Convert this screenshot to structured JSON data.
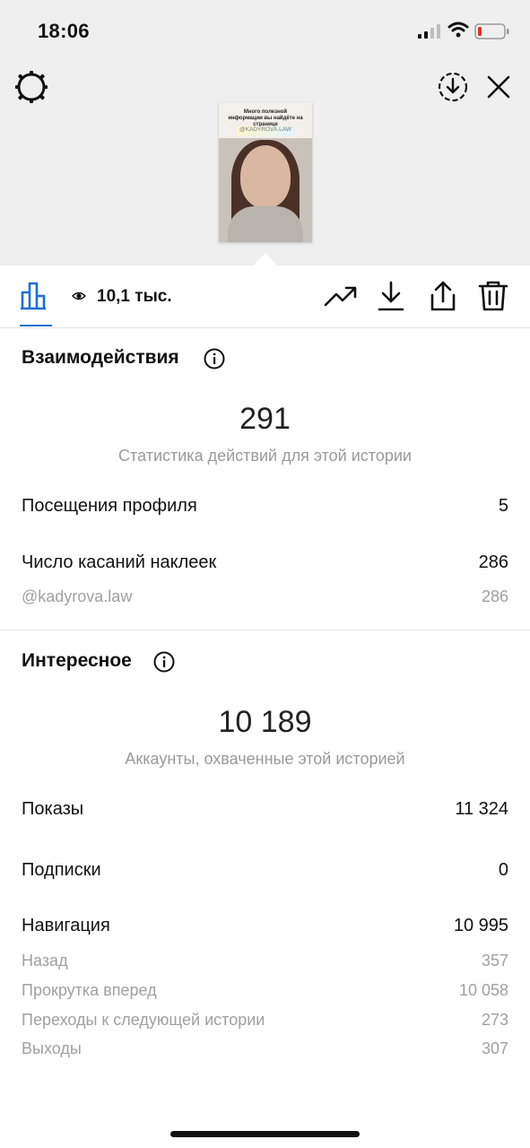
{
  "status_bar": {
    "time": "18:06",
    "icons": [
      "signal-icon",
      "wifi-icon",
      "battery-icon"
    ],
    "battery_color": "#e0312c"
  },
  "header": {
    "icons": [
      "settings-icon",
      "download-circle-icon",
      "close-icon"
    ]
  },
  "story_thumbnail": {
    "caption": "Много полезной информации вы найдёте на странице",
    "handle": "@KADYROVA.LAW"
  },
  "toolbar": {
    "views": "10,1 тыс.",
    "icons": [
      "bar-chart-icon",
      "eye-icon",
      "trend-icon",
      "download-icon",
      "share-icon",
      "trash-icon"
    ],
    "active_color": "#1b6fd1"
  },
  "interactions": {
    "title": "Взаимодействия",
    "total": "291",
    "caption": "Статистика действий для этой истории",
    "rows": [
      {
        "label": "Посещения профиля",
        "value": "5"
      },
      {
        "label": "Число касаний наклеек",
        "value": "286"
      }
    ],
    "sub_rows": [
      {
        "label": "@kadyrova.law",
        "value": "286"
      }
    ]
  },
  "discovery": {
    "title": "Интересное",
    "total": "10 189",
    "caption": "Аккаунты, охваченные этой историей",
    "rows": [
      {
        "label": "Показы",
        "value": "11 324"
      },
      {
        "label": "Подписки",
        "value": "0"
      },
      {
        "label": "Навигация",
        "value": "10 995"
      }
    ],
    "nav_rows": [
      {
        "label": "Назад",
        "value": "357"
      },
      {
        "label": "Прокрутка вперед",
        "value": "10 058"
      },
      {
        "label": "Переходы к следующей истории",
        "value": "273"
      },
      {
        "label": "Выходы",
        "value": "307"
      }
    ]
  }
}
